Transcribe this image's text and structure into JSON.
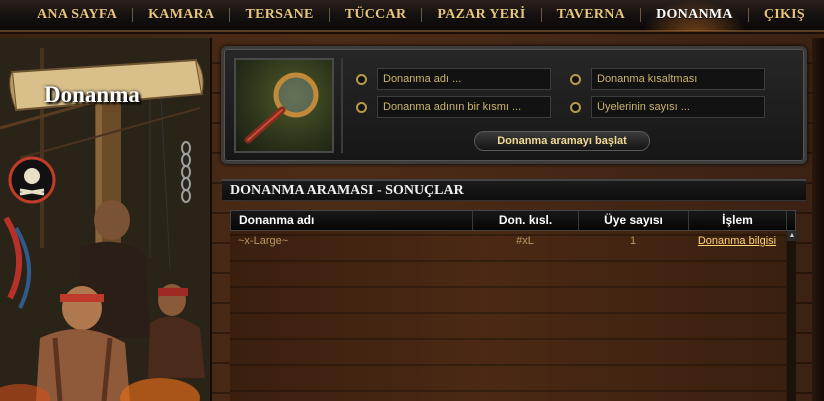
{
  "nav": {
    "items": [
      {
        "label": "ANA SAYFA"
      },
      {
        "label": "KAMARA"
      },
      {
        "label": "TERSANE"
      },
      {
        "label": "TÜCCAR"
      },
      {
        "label": "PAZAR YERİ"
      },
      {
        "label": "TAVERNA"
      },
      {
        "label": "DONANMA"
      },
      {
        "label": "ÇIKIŞ"
      }
    ],
    "active": "DONANMA"
  },
  "side": {
    "banner_title": "Donanma"
  },
  "search": {
    "field_name": "Donanma adı ...",
    "field_partial": "Donanma adının bir kısmı ...",
    "field_abbr": "Donanma kısaltması",
    "field_members": "Üyelerinin sayısı ...",
    "button_label": "Donanma aramayı başlat"
  },
  "results": {
    "title": "DONANMA ARAMASI - SONUÇLAR",
    "columns": [
      "Donanma adı",
      "Don. kısl.",
      "Üye sayısı",
      "İşlem"
    ],
    "rows": [
      {
        "name": "~x-Large~",
        "abbr": "#xL",
        "members": "1",
        "action": "Donanma bilgisi"
      }
    ]
  },
  "colors": {
    "accent_gold": "#e8c57a",
    "link": "#ffd37a",
    "wood": "#4b2914"
  }
}
